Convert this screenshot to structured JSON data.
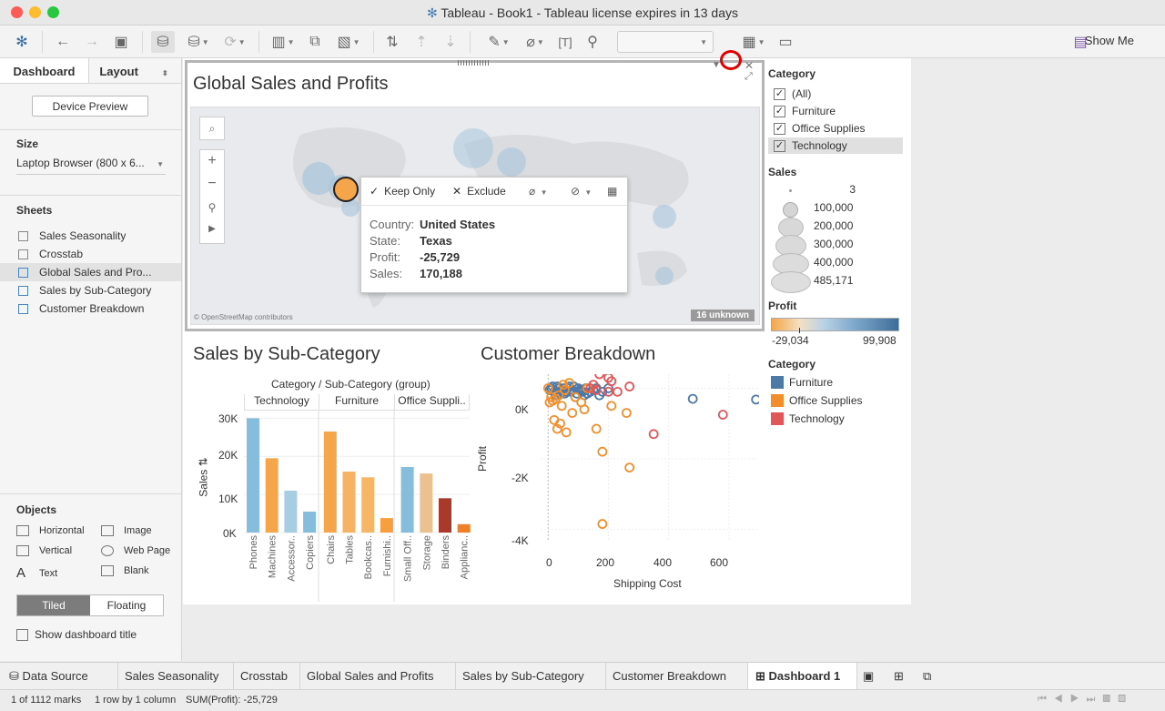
{
  "window": {
    "title": "Tableau - Book1 - Tableau license expires in 13 days"
  },
  "toolbar": {
    "show_me_label": "Show Me"
  },
  "left_panel": {
    "tabs": [
      "Dashboard",
      "Layout"
    ],
    "device_preview": "Device Preview",
    "size_heading": "Size",
    "size_value": "Laptop Browser (800 x 6...",
    "sheets_heading": "Sheets",
    "sheets": [
      "Sales Seasonality",
      "Crosstab",
      "Global Sales and Pro...",
      "Sales by Sub-Category",
      "Customer Breakdown"
    ],
    "objects_heading": "Objects",
    "objects": [
      "Horizontal",
      "Image",
      "Vertical",
      "Web Page",
      "Text",
      "Blank"
    ],
    "tiled": "Tiled",
    "floating": "Floating",
    "show_title": "Show dashboard title"
  },
  "map": {
    "title": "Global Sales and Profits",
    "attribution": "© OpenStreetMap contributors",
    "unknown": "16 unknown"
  },
  "tooltip": {
    "keep_only": "Keep Only",
    "exclude": "Exclude",
    "country_label": "Country:",
    "country_value": "United States",
    "state_label": "State:",
    "state_value": "Texas",
    "profit_label": "Profit:",
    "profit_value": "-25,729",
    "sales_label": "Sales:",
    "sales_value": "170,188"
  },
  "legends": {
    "category_filter_heading": "Category",
    "category_filter": [
      "(All)",
      "Furniture",
      "Office Supplies",
      "Technology"
    ],
    "sales_heading": "Sales",
    "sales_sizes": [
      "3",
      "100,000",
      "200,000",
      "300,000",
      "400,000",
      "485,171"
    ],
    "profit_heading": "Profit",
    "profit_min": "-29,034",
    "profit_max": "99,908",
    "category_heading": "Category",
    "categories": [
      {
        "name": "Furniture",
        "color": "#4e79a7"
      },
      {
        "name": "Office Supplies",
        "color": "#f28e2b"
      },
      {
        "name": "Technology",
        "color": "#e15759"
      }
    ]
  },
  "bar_chart": {
    "title": "Sales by Sub-Category",
    "header": "Category / Sub-Category (group)",
    "groups": [
      "Technology",
      "Furniture",
      "Office Suppli.."
    ],
    "ylabel": "Sales",
    "yticks": [
      "30K",
      "20K",
      "10K",
      "0K"
    ],
    "labels": [
      "Phones",
      "Machines",
      "Accessor..",
      "Copiers",
      "Chairs",
      "Tables",
      "Bookcas..",
      "Furnishi..",
      "Small Off..",
      "Storage",
      "Binders",
      "Applianc.."
    ]
  },
  "scatter": {
    "title": "Customer Breakdown",
    "xlabel": "Shipping Cost",
    "ylabel": "Profit",
    "yticks": [
      "0K",
      "-2K",
      "-4K"
    ],
    "xticks": [
      "0",
      "200",
      "400",
      "600"
    ]
  },
  "chart_data": [
    {
      "type": "bar",
      "title": "Sales by Sub-Category",
      "ylabel": "Sales",
      "ylim": [
        0,
        32000
      ],
      "categories": [
        "Phones",
        "Machines",
        "Accessor..",
        "Copiers",
        "Chairs",
        "Tables",
        "Bookcas..",
        "Furnishi..",
        "Small Off..",
        "Storage",
        "Binders",
        "Applianc.."
      ],
      "values": [
        30000,
        19500,
        11000,
        5500,
        26500,
        16000,
        14500,
        3800,
        17200,
        15500,
        9000,
        2200
      ],
      "colors": [
        "#86bcdc",
        "#f5a54a",
        "#a6cde2",
        "#86bcdc",
        "#f5a54a",
        "#f8b263",
        "#f9b566",
        "#f79f3e",
        "#86bcdc",
        "#eac18f",
        "#a9392a",
        "#ef7f28"
      ]
    },
    {
      "type": "scatter",
      "title": "Customer Breakdown",
      "xlabel": "Shipping Cost",
      "ylabel": "Profit",
      "xlim": [
        -25,
        700
      ],
      "ylim": [
        -4300,
        400
      ],
      "series": [
        {
          "name": "Furniture",
          "color": "#4e79a7",
          "points": [
            [
              10,
              0
            ],
            [
              20,
              -100
            ],
            [
              30,
              50
            ],
            [
              40,
              -150
            ],
            [
              50,
              0
            ],
            [
              60,
              -100
            ],
            [
              70,
              50
            ],
            [
              80,
              -50
            ],
            [
              90,
              -250
            ],
            [
              100,
              0
            ],
            [
              110,
              -80
            ],
            [
              120,
              -200
            ],
            [
              140,
              -100
            ],
            [
              160,
              0
            ],
            [
              180,
              -100
            ],
            [
              200,
              0
            ],
            [
              5,
              -50
            ],
            [
              15,
              50
            ],
            [
              25,
              -200
            ],
            [
              35,
              0
            ],
            [
              45,
              -50
            ],
            [
              55,
              -150
            ],
            [
              65,
              0
            ],
            [
              75,
              -100
            ],
            [
              85,
              50
            ],
            [
              95,
              -150
            ],
            [
              105,
              -50
            ],
            [
              115,
              -100
            ],
            [
              125,
              0
            ],
            [
              130,
              -150
            ],
            [
              150,
              -50
            ],
            [
              170,
              -200
            ],
            [
              480,
              -300
            ],
            [
              690,
              -320
            ]
          ]
        },
        {
          "name": "Office Supplies",
          "color": "#f28e2b",
          "points": [
            [
              5,
              -400
            ],
            [
              15,
              -350
            ],
            [
              25,
              -300
            ],
            [
              35,
              -200
            ],
            [
              50,
              100
            ],
            [
              70,
              150
            ],
            [
              90,
              -250
            ],
            [
              110,
              -400
            ],
            [
              130,
              0
            ],
            [
              160,
              -1150
            ],
            [
              20,
              -900
            ],
            [
              30,
              -1150
            ],
            [
              40,
              -1000
            ],
            [
              60,
              -1250
            ],
            [
              80,
              -700
            ],
            [
              180,
              -1800
            ],
            [
              210,
              -500
            ],
            [
              180,
              -3850
            ],
            [
              270,
              -2250
            ],
            [
              260,
              -700
            ],
            [
              10,
              -250
            ],
            [
              45,
              -500
            ],
            [
              55,
              -50
            ],
            [
              120,
              -600
            ],
            [
              0,
              0
            ]
          ]
        },
        {
          "name": "Technology",
          "color": "#e15759",
          "points": [
            [
              150,
              100
            ],
            [
              170,
              400
            ],
            [
              200,
              300
            ],
            [
              200,
              -100
            ],
            [
              210,
              200
            ],
            [
              230,
              -100
            ],
            [
              270,
              550
            ],
            [
              270,
              50
            ],
            [
              350,
              -1300
            ],
            [
              580,
              -750
            ],
            [
              140,
              0
            ],
            [
              160,
              -50
            ]
          ]
        }
      ]
    }
  ]
}
